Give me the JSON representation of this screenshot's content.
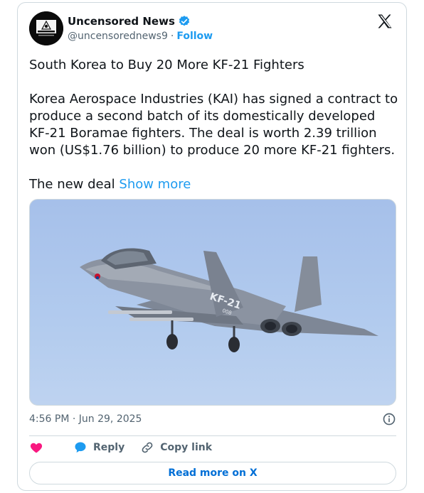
{
  "author": {
    "display_name": "Uncensored News",
    "handle": "@uncensorednews9",
    "separator": "·",
    "follow_label": "Follow",
    "avatar_text_top": "UNCENSORED NEWS",
    "verified_color": "#1d9bf0"
  },
  "tweet": {
    "title": "South Korea to Buy 20 More KF-21 Fighters",
    "body": "Korea Aerospace Industries (KAI) has signed a contract to produce a second batch of its domestically developed KF-21 Boramae fighters. The deal is worth 2.39 trillion won (US$1.76 billion) to produce 20 more KF-21 fighters.",
    "teaser": "The new deal",
    "show_more_label": "Show more",
    "media_marking": "KF-21",
    "media_tail_number": "008"
  },
  "meta": {
    "time": "4:56 PM",
    "separator": "·",
    "date": "Jun 29, 2025"
  },
  "actions": {
    "like_label": "",
    "reply_label": "Reply",
    "copy_link_label": "Copy link",
    "like_color": "#f91880",
    "reply_color": "#1d9bf0"
  },
  "footer": {
    "read_more_label": "Read more on X"
  },
  "icons": [
    "x-logo-icon",
    "verified-badge-icon",
    "info-icon",
    "heart-icon",
    "reply-bubble-icon",
    "link-icon"
  ]
}
